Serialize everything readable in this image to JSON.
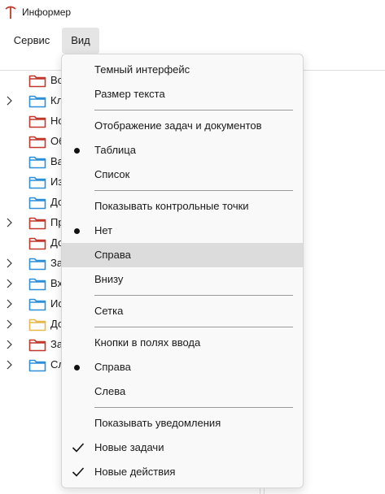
{
  "app": {
    "title": "Информер"
  },
  "menubar": {
    "service": "Сервис",
    "view": "Вид"
  },
  "tree": {
    "items": [
      {
        "label": "Во",
        "color": "#c0392b",
        "expandable": false
      },
      {
        "label": "Кл",
        "color": "#2e8fd9",
        "expandable": true
      },
      {
        "label": "Но",
        "color": "#c0392b",
        "expandable": false
      },
      {
        "label": "Об",
        "color": "#c0392b",
        "expandable": false
      },
      {
        "label": "Ва",
        "color": "#2e8fd9",
        "expandable": false
      },
      {
        "label": "Из",
        "color": "#2e8fd9",
        "expandable": false
      },
      {
        "label": "До",
        "color": "#2e8fd9",
        "expandable": false
      },
      {
        "label": "Пр",
        "color": "#c0392b",
        "expandable": true
      },
      {
        "label": "До",
        "color": "#c0392b",
        "expandable": false
      },
      {
        "label": "За",
        "color": "#2e8fd9",
        "expandable": true
      },
      {
        "label": "Вх",
        "color": "#2e8fd9",
        "expandable": true
      },
      {
        "label": "Ис",
        "color": "#2e8fd9",
        "expandable": true
      },
      {
        "label": "До",
        "color": "#e6b84a",
        "expandable": true
      },
      {
        "label": "За",
        "color": "#c0392b",
        "expandable": true
      },
      {
        "label": "Сл",
        "color": "#2e8fd9",
        "expandable": true
      }
    ]
  },
  "view_menu": {
    "dark_theme": "Темный интерфейс",
    "text_size": "Размер текста",
    "tasks_display_header": "Отображение задач и документов",
    "table": "Таблица",
    "list": "Список",
    "checkpoints_header": "Показывать контрольные точки",
    "none": "Нет",
    "right": "Справа",
    "bottom": "Внизу",
    "grid": "Сетка",
    "input_buttons_header": "Кнопки в полях ввода",
    "buttons_right": "Справа",
    "buttons_left": "Слева",
    "notifications_header": "Показывать уведомления",
    "new_tasks": "Новые задачи",
    "new_actions": "Новые действия"
  },
  "colors": {
    "accent_red": "#c0392b",
    "folder_blue": "#2e8fd9",
    "folder_yellow": "#e6b84a",
    "highlight": "#dcdcdc"
  }
}
